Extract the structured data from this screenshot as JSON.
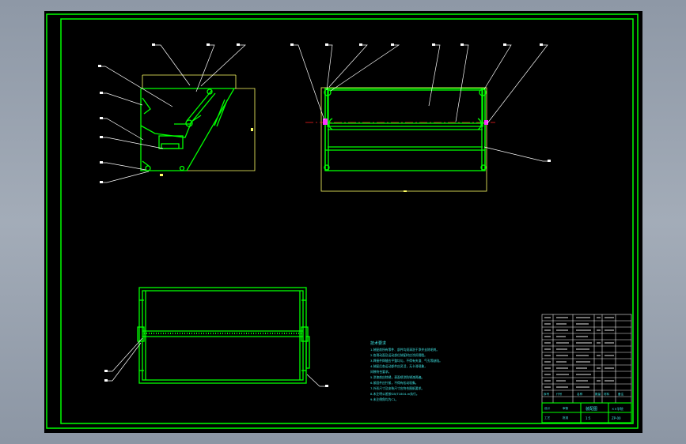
{
  "viewer": {
    "background": "#000000",
    "frame_color": "#00ff00",
    "outline_color": "#ffff66",
    "leader_color": "#ffffff",
    "annotation_color": "#40e8e8",
    "centerline_color": "#ff2020"
  },
  "notes": {
    "heading": "技术要求",
    "lines": [
      "1.装配前所有零件、部件均须清洗干净并去除毛刺。",
      "2.各滑动面及运动部位装配时应涂润滑脂。",
      "3.焊接件焊缝应平整均匀，不得有夹渣、气孔等缺陷。",
      "4.装配后各运动部件应灵活，无卡滞现象，",
      "   间隙符合要求。",
      "5.涂漆前应除锈，表面喷涂防锈漆两遍。",
      "6.紧固件应拧紧，不得有松动现象。",
      "7.外形尺寸及安装尺寸应符合图纸要求。",
      "8.未注明公差按GB/T1804-m执行。",
      "9.未注倒角均为C1。"
    ]
  },
  "title_block": {
    "drawing_name": "装配图",
    "company": "××学院",
    "drawing_number": "ZP-00",
    "row_labels": [
      "序号",
      "代号",
      "名称",
      "数量",
      "材料",
      "备注"
    ],
    "sign_labels": [
      "设计",
      "审核",
      "工艺",
      "批准"
    ],
    "scale": "1:5"
  }
}
